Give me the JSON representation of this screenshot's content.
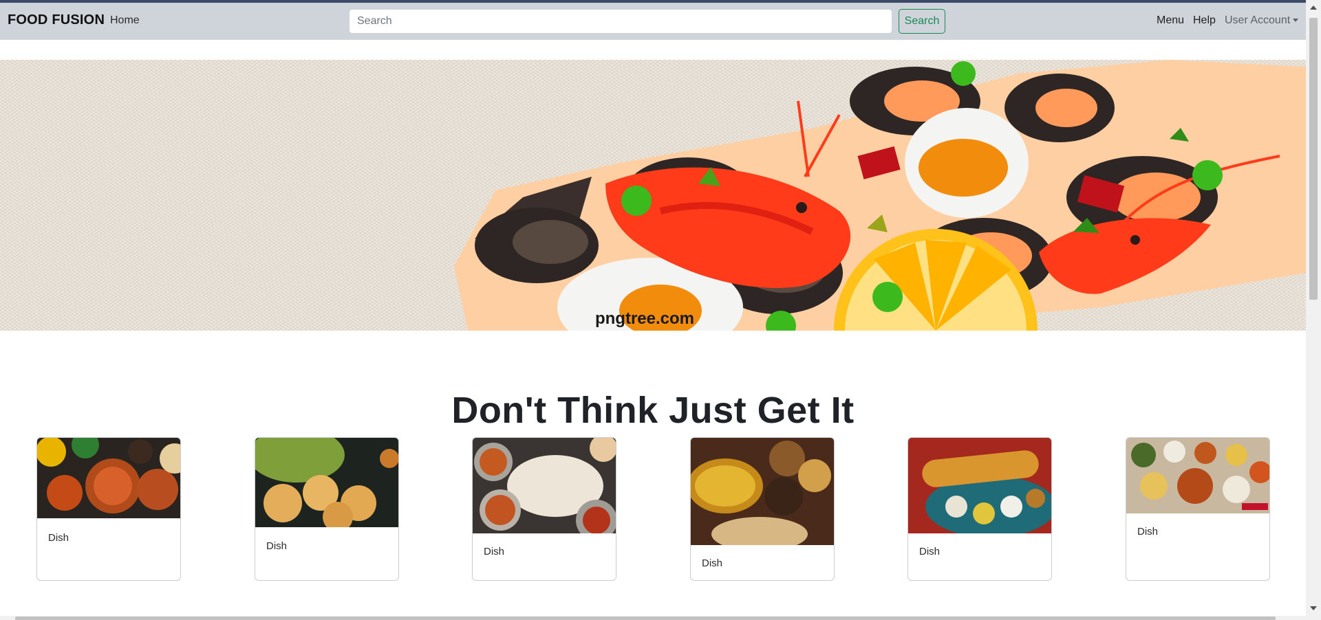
{
  "navbar": {
    "brand": "FOOD FUSION",
    "home": "Home",
    "search_placeholder": "Search",
    "search_button": "Search",
    "menu": "Menu",
    "help": "Help",
    "account": "User Account"
  },
  "hero": {
    "watermark": "pngtree.com"
  },
  "section": {
    "heading": "Don't Think Just Get It"
  },
  "cards": [
    {
      "label": "Dish"
    },
    {
      "label": "Dish"
    },
    {
      "label": "Dish"
    },
    {
      "label": "Dish"
    },
    {
      "label": "Dish"
    },
    {
      "label": "Dish"
    }
  ],
  "colors": {
    "navbar_bg": "#cfd4da",
    "accent_green": "#198754"
  }
}
